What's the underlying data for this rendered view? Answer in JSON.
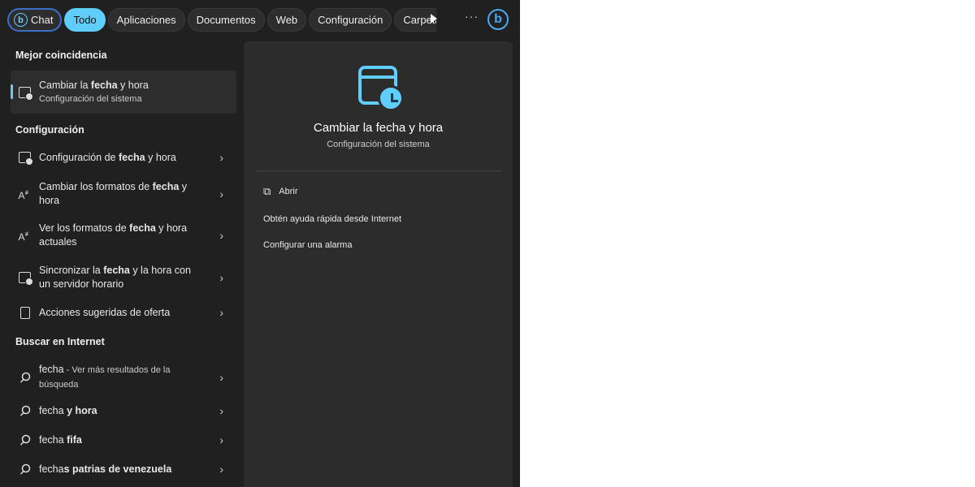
{
  "tabs": [
    {
      "label": "Chat"
    },
    {
      "label": "Todo",
      "active": true
    },
    {
      "label": "Aplicaciones"
    },
    {
      "label": "Documentos"
    },
    {
      "label": "Web"
    },
    {
      "label": "Configuración"
    },
    {
      "label": "Carpeta"
    }
  ],
  "more_label": "···",
  "accent": "#60cdff",
  "best_match": {
    "heading": "Mejor coincidencia",
    "title": [
      {
        "t": "Cambiar la "
      },
      {
        "t": "fecha",
        "b": true
      },
      {
        "t": " y hora"
      }
    ],
    "subtitle": "Configuración del sistema",
    "icon": "calendar-clock-icon"
  },
  "settings": {
    "heading": "Configuración",
    "items": [
      {
        "icon": "calendar-clock-icon",
        "segs": [
          {
            "t": "Configuración de "
          },
          {
            "t": "fecha",
            "b": true
          },
          {
            "t": " y hora"
          }
        ]
      },
      {
        "icon": "text-format-icon",
        "segs": [
          {
            "t": "Cambiar los formatos de "
          },
          {
            "t": "fecha",
            "b": true
          },
          {
            "t": " y hora"
          }
        ]
      },
      {
        "icon": "text-format-icon",
        "segs": [
          {
            "t": "Ver los formatos de "
          },
          {
            "t": "fecha",
            "b": true
          },
          {
            "t": " y hora actuales"
          }
        ]
      },
      {
        "icon": "calendar-clock-icon",
        "segs": [
          {
            "t": "Sincronizar la "
          },
          {
            "t": "fecha",
            "b": true
          },
          {
            "t": " y la hora con un servidor horario"
          }
        ]
      },
      {
        "icon": "clipboard-icon",
        "segs": [
          {
            "t": "Acciones sugeridas de oferta"
          }
        ]
      }
    ]
  },
  "web": {
    "heading": "Buscar en Internet",
    "items": [
      {
        "icon": "search-icon",
        "segs": [
          {
            "t": "fecha"
          },
          {
            "t": " - Ver más resultados de la búsqueda",
            "s": true
          }
        ]
      },
      {
        "icon": "search-icon",
        "segs": [
          {
            "t": "fecha"
          },
          {
            "t": " y hora",
            "b": true
          }
        ]
      },
      {
        "icon": "search-icon",
        "segs": [
          {
            "t": "fecha"
          },
          {
            "t": " fifa",
            "b": true
          }
        ]
      },
      {
        "icon": "search-icon",
        "segs": [
          {
            "t": "fecha"
          },
          {
            "t": "s patrias de venezuela",
            "b": true
          }
        ]
      }
    ]
  },
  "preview": {
    "title": "Cambiar la fecha y hora",
    "subtitle": "Configuración del sistema",
    "actions": [
      {
        "label": "Abrir",
        "icon": "open-external-icon"
      },
      {
        "label": "Obtén ayuda rápida desde Internet"
      },
      {
        "label": "Configurar una alarma"
      }
    ]
  }
}
